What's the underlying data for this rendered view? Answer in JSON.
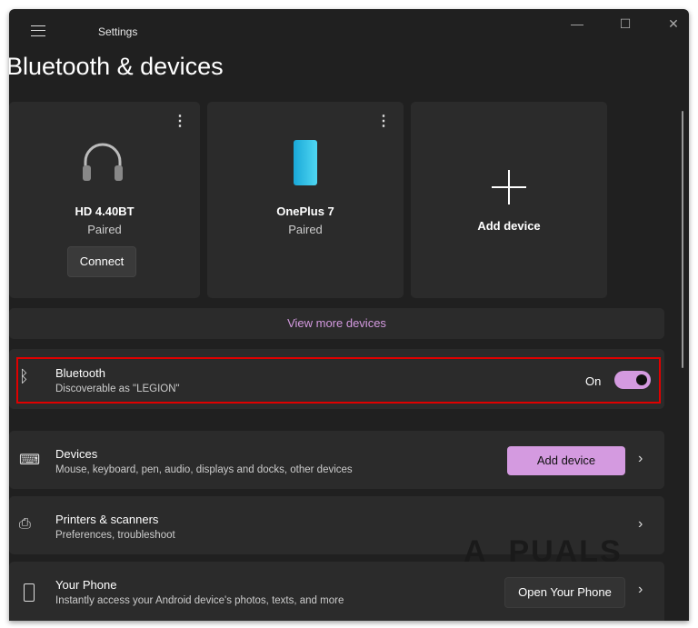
{
  "window": {
    "app_title": "Settings",
    "minimize": "—",
    "maximize": "☐",
    "close": "✕"
  },
  "page_title": "Bluetooth & devices",
  "device_cards": [
    {
      "name": "HD 4.40BT",
      "status": "Paired",
      "action": "Connect",
      "icon": "headphones-icon"
    },
    {
      "name": "OnePlus 7",
      "status": "Paired",
      "icon": "phone-icon"
    },
    {
      "name": "Add device",
      "icon": "plus-icon"
    }
  ],
  "view_more": "View more devices",
  "bluetooth": {
    "title": "Bluetooth",
    "subtitle": "Discoverable as \"LEGION\"",
    "state": "On",
    "enabled": true
  },
  "rows": [
    {
      "title": "Devices",
      "subtitle": "Mouse, keyboard, pen, audio, displays and docks, other devices",
      "button": "Add device"
    },
    {
      "title": "Printers & scanners",
      "subtitle": "Preferences, troubleshoot"
    },
    {
      "title": "Your Phone",
      "subtitle": "Instantly access your Android device's photos, texts, and more",
      "button": "Open Your Phone"
    }
  ],
  "watermark": "APPUALS",
  "colors": {
    "accent": "#d49ae0",
    "highlight": "#e00000"
  }
}
